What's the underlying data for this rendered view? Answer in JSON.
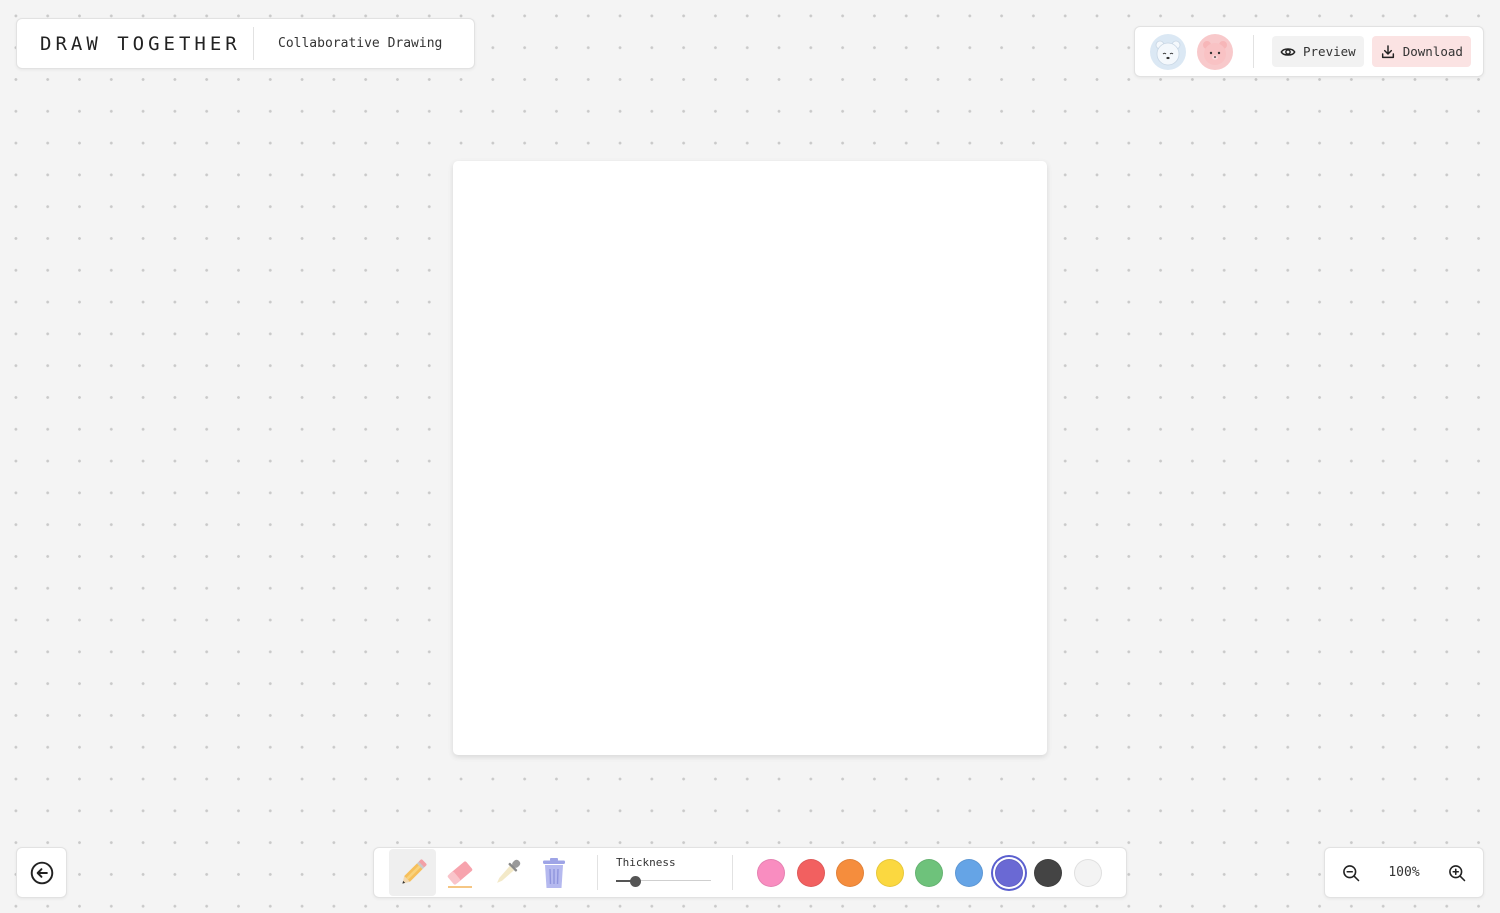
{
  "header": {
    "title": "DRAW TOGETHER",
    "subtitle": "Collaborative Drawing"
  },
  "top_bar": {
    "avatars": [
      {
        "name": "polar-bear-avatar",
        "bg": "#dbe8f4"
      },
      {
        "name": "pink-bear-avatar",
        "bg": "#f8c9cb"
      }
    ],
    "preview_label": "Preview",
    "download_label": "Download"
  },
  "toolbar": {
    "tools": [
      {
        "name": "pencil-icon",
        "active": true
      },
      {
        "name": "eraser-icon",
        "active": false
      },
      {
        "name": "eyedropper-icon",
        "active": false
      },
      {
        "name": "trash-icon",
        "active": false
      }
    ],
    "thickness_label": "Thickness",
    "thickness_value": 0.2,
    "colors": [
      {
        "hex": "#f98dc0",
        "selected": false
      },
      {
        "hex": "#f26060",
        "selected": false
      },
      {
        "hex": "#f58d3d",
        "selected": false
      },
      {
        "hex": "#fbd840",
        "selected": false
      },
      {
        "hex": "#6ec27b",
        "selected": false
      },
      {
        "hex": "#65a4e6",
        "selected": false
      },
      {
        "hex": "#6a69d4",
        "selected": true
      },
      {
        "hex": "#444444",
        "selected": false
      },
      {
        "hex": "#f3f3f3",
        "selected": false
      }
    ]
  },
  "zoom": {
    "level": "100%"
  }
}
